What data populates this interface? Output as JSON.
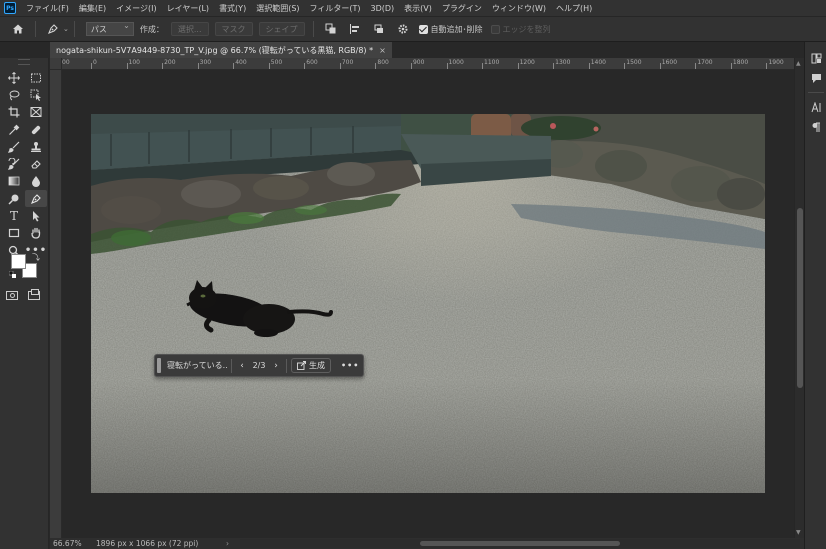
{
  "app": {
    "logo_text": "Ps",
    "menu": [
      "ファイル(F)",
      "編集(E)",
      "イメージ(I)",
      "レイヤー(L)",
      "書式(Y)",
      "選択範囲(S)",
      "フィルター(T)",
      "3D(D)",
      "表示(V)",
      "プラグイン",
      "ウィンドウ(W)",
      "ヘルプ(H)"
    ]
  },
  "options_bar": {
    "mode_select": "パス",
    "make_label": "作成：",
    "btn_selection": "選択...",
    "btn_mask": "マスク",
    "btn_shape": "シェイプ",
    "auto_add_label": "自動追加･削除",
    "auto_add_checked": true,
    "align_edges_label": "エッジを整列",
    "align_edges_checked": false
  },
  "document": {
    "tab_title": "nogata-shikun-5V7A9449-8730_TP_V.jpg @ 66.7% (寝転がっている黒猫, RGB/8) *",
    "close_glyph": "×"
  },
  "ruler": {
    "labels": [
      "0",
      "100",
      "200",
      "300",
      "400",
      "500",
      "600",
      "700",
      "800",
      "900",
      "1000",
      "1100",
      "1200",
      "1300",
      "1400",
      "1500",
      "1600",
      "1700",
      "1800",
      "1900"
    ],
    "start_label": "00"
  },
  "context_bar": {
    "prompt": "寝転がっている...",
    "counter": "2/3",
    "prev": "‹",
    "next": "›",
    "generate": "生成",
    "more": "•••"
  },
  "status": {
    "zoom": "66.67%",
    "size": "1896 px x 1066 px (72 ppi)",
    "arrow": "›"
  },
  "colors": {
    "foreground": "#ffffff",
    "background": "#ffffff",
    "accent": "#31a8ff"
  },
  "icons": {
    "options": [
      "home-icon",
      "pen-tool-icon",
      "path-operations-icon",
      "path-alignment-icon",
      "path-arrangement-icon",
      "gear-icon"
    ],
    "tools": [
      "move-icon",
      "marquee-icon",
      "lasso-icon",
      "object-select-icon",
      "crop-icon",
      "frame-icon",
      "eyedropper-icon",
      "spot-healing-icon",
      "brush-icon",
      "clone-stamp-icon",
      "history-brush-icon",
      "eraser-icon",
      "gradient-icon",
      "blur-icon",
      "dodge-icon",
      "pen-icon",
      "type-icon",
      "path-select-icon",
      "rectangle-icon",
      "hand-icon",
      "zoom-icon",
      "more-tools-icon"
    ],
    "right_panel": [
      "libraries-icon",
      "comments-icon",
      "character-icon",
      "paragraph-icon"
    ]
  }
}
